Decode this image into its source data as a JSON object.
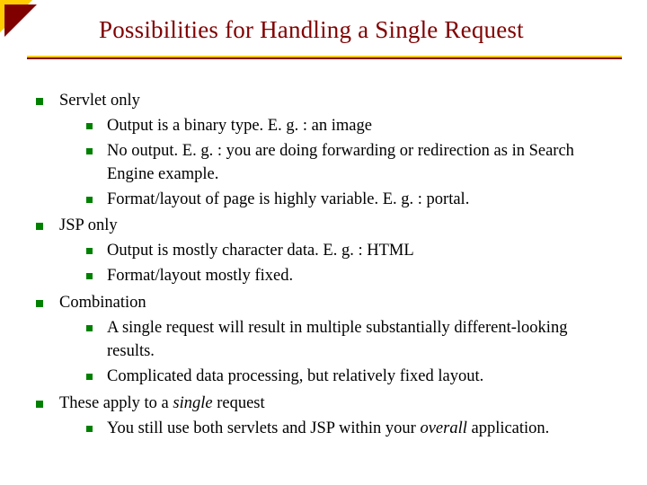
{
  "title": "Possibilities for Handling a Single Request",
  "bullets": {
    "b0": {
      "head": "Servlet only",
      "subs": {
        "s0": "Output is a binary type. E. g. : an image",
        "s1": "No output. E. g. : you are doing forwarding or redirection as in Search Engine example.",
        "s2": "Format/layout of page is highly variable. E. g. : portal."
      }
    },
    "b1": {
      "head": "JSP only",
      "subs": {
        "s0": "Output is mostly character data. E. g. : HTML",
        "s1": "Format/layout mostly fixed."
      }
    },
    "b2": {
      "head": "Combination",
      "subs": {
        "s0": "A single request will result in multiple substantially different-looking results.",
        "s1": "Complicated data processing, but relatively fixed layout."
      }
    },
    "b3": {
      "head_pre": "These apply to a ",
      "head_em": "single",
      "head_post": " request",
      "subs": {
        "s0_pre": "You still use both servlets and JSP within your ",
        "s0_em": "overall",
        "s0_post": " application."
      }
    }
  }
}
